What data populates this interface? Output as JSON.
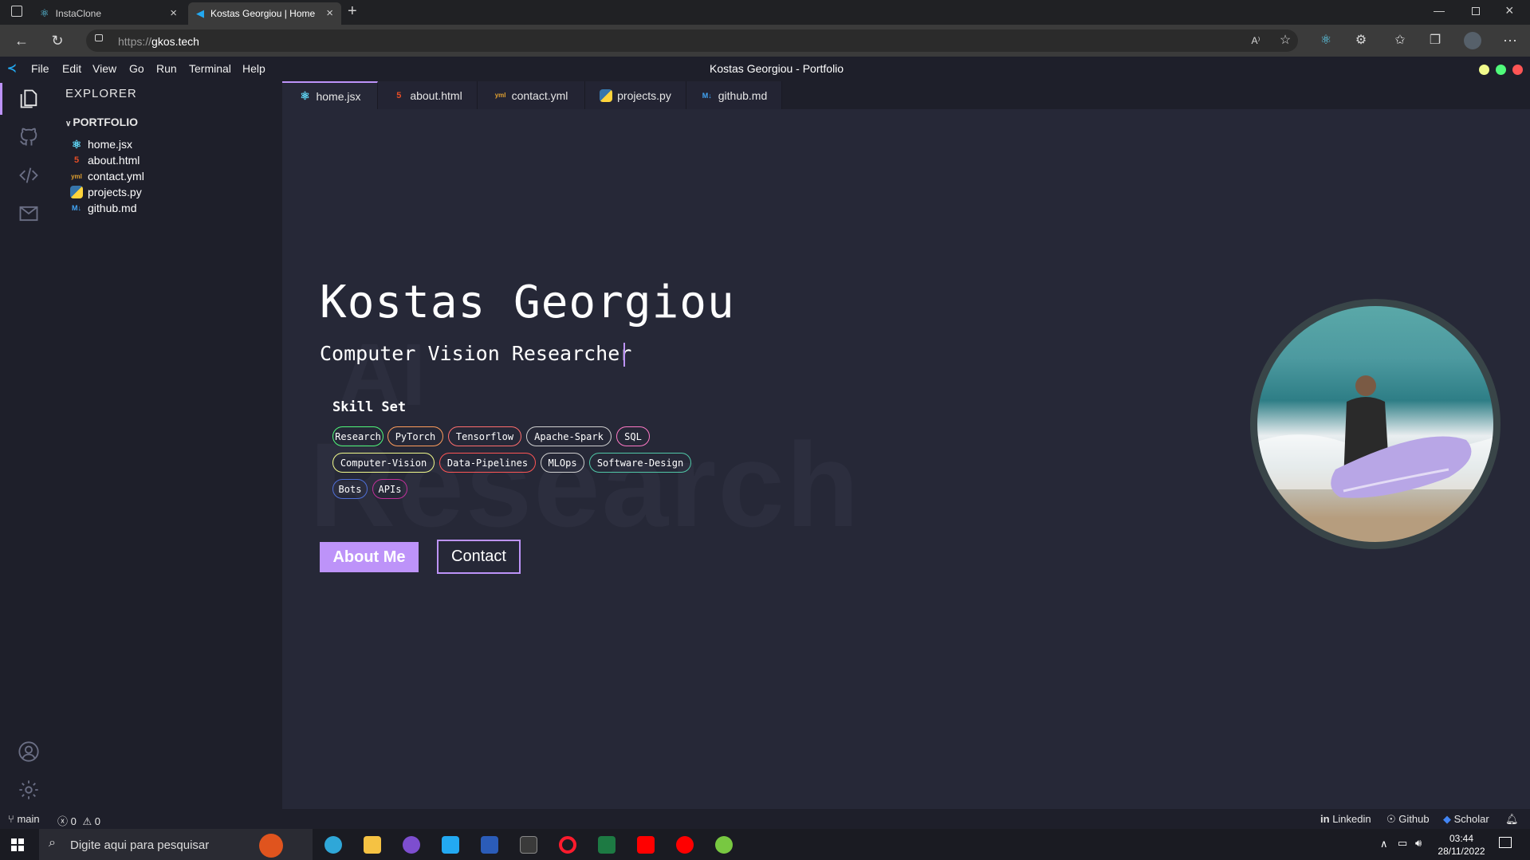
{
  "browser": {
    "tabs": [
      {
        "label": "InstaClone",
        "active": false
      },
      {
        "label": "Kostas Georgiou | Home",
        "active": true
      }
    ],
    "url_prefix": "https://",
    "url_host": "gkos.tech"
  },
  "menubar": {
    "items": [
      "File",
      "Edit",
      "View",
      "Go",
      "Run",
      "Terminal",
      "Help"
    ],
    "title": "Kostas Georgiou - Portfolio"
  },
  "sidebar": {
    "title": "EXPLORER",
    "folder": "PORTFOLIO",
    "files": [
      {
        "name": "home.jsx",
        "icon": "react-icon"
      },
      {
        "name": "about.html",
        "icon": "html5-icon"
      },
      {
        "name": "contact.yml",
        "icon": "yaml-icon"
      },
      {
        "name": "projects.py",
        "icon": "python-icon"
      },
      {
        "name": "github.md",
        "icon": "markdown-icon"
      }
    ]
  },
  "editor_tabs": [
    {
      "label": "home.jsx",
      "active": true
    },
    {
      "label": "about.html",
      "active": false
    },
    {
      "label": "contact.yml",
      "active": false
    },
    {
      "label": "projects.py",
      "active": false
    },
    {
      "label": "github.md",
      "active": false
    }
  ],
  "hero": {
    "bg_word_1": "AI",
    "bg_word_2": "Research",
    "name": "Kostas Georgiou",
    "role": "Computer Vision Researcher",
    "skills_title": "Skill Set",
    "skills": [
      {
        "label": "Research",
        "color": "#50fa7b"
      },
      {
        "label": "PyTorch",
        "color": "#ff9d5c"
      },
      {
        "label": "Tensorflow",
        "color": "#ff6e6e"
      },
      {
        "label": "Apache-Spark",
        "color": "#d0d0d0"
      },
      {
        "label": "SQL",
        "color": "#ff79c6"
      },
      {
        "label": "Computer-Vision",
        "color": "#f1fa8c"
      },
      {
        "label": "Data-Pipelines",
        "color": "#ff5555"
      },
      {
        "label": "MLOps",
        "color": "#d0d0d0"
      },
      {
        "label": "Software-Design",
        "color": "#50c8a8"
      },
      {
        "label": "Bots",
        "color": "#4f6fd8"
      },
      {
        "label": "APIs",
        "color": "#c0309a"
      }
    ],
    "about_button": "About Me",
    "contact_button": "Contact"
  },
  "statusbar": {
    "branch": "main",
    "errors": "0",
    "warnings": "0",
    "linkedin": "Linkedin",
    "github": "Github",
    "scholar": "Scholar"
  },
  "taskbar": {
    "search_placeholder": "Digite aqui para pesquisar",
    "time": "03:44",
    "date": "28/11/2022"
  },
  "colors": {
    "accent": "#bd93f9",
    "editor_bg": "#262837",
    "sidebar_bg": "#1e1f2a"
  }
}
